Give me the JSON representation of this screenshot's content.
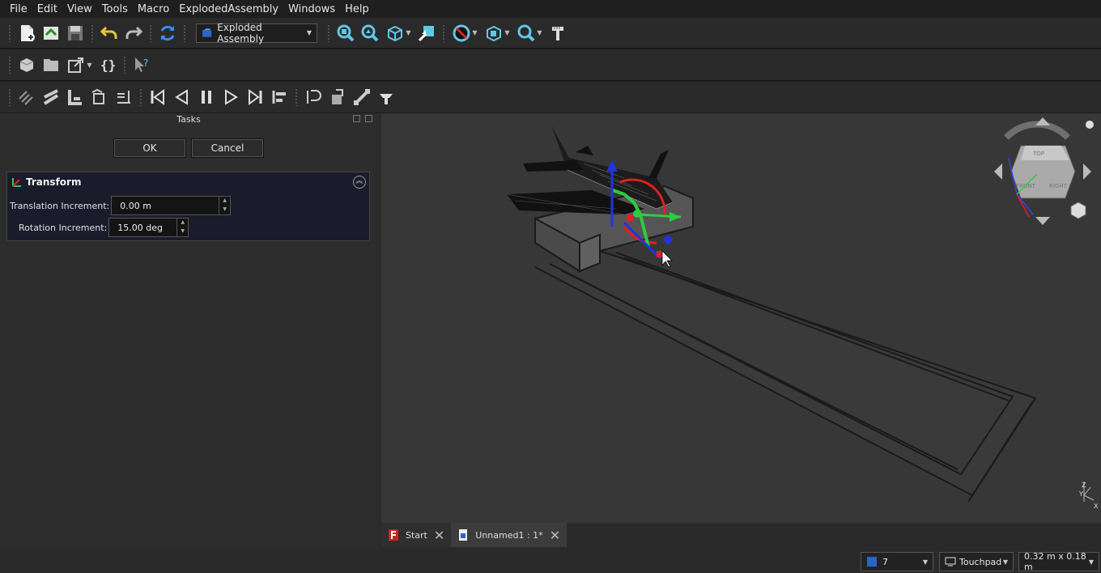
{
  "menu": [
    "File",
    "Edit",
    "View",
    "Tools",
    "Macro",
    "ExplodedAssembly",
    "Windows",
    "Help"
  ],
  "workbench": {
    "selected": "Exploded Assembly"
  },
  "tasks": {
    "title": "Tasks",
    "ok_label": "OK",
    "cancel_label": "Cancel"
  },
  "transform": {
    "title": "Transform",
    "translation_label": "Translation Increment:",
    "translation_value": "0.00 m",
    "rotation_label": "Rotation Increment:",
    "rotation_value": "15.00 deg"
  },
  "navcube": {
    "top": "TOP",
    "right": "RIGHT",
    "front": "FRONT"
  },
  "axis": {
    "z": "Z",
    "y": "Y",
    "x": "X"
  },
  "tabs": [
    {
      "label": "Start"
    },
    {
      "label": "Unnamed1 : 1*"
    }
  ],
  "status": {
    "layer_value": "7",
    "nav_style": "Touchpad",
    "dimensions": "0.32 m x 0.18 m"
  },
  "colors": {
    "accent_blue": "#2b64c8",
    "gizmo_green": "#2ecc40",
    "gizmo_red": "#e02020",
    "gizmo_blue": "#2233dd"
  }
}
